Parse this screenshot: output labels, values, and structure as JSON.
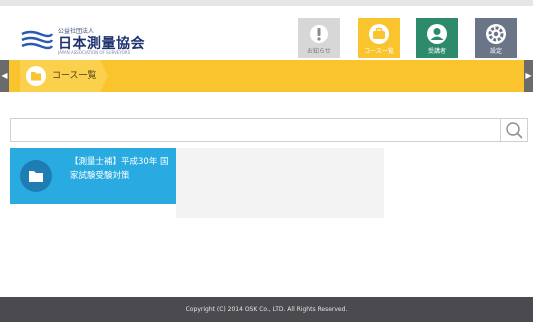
{
  "header": {
    "org_sub": "公益社団法人",
    "org_name": "日本測量協会",
    "org_en": "JAPAN ASSOCIATION OF SURVEYORS",
    "nav": [
      {
        "key": "news",
        "label": "お知らせ",
        "icon": "exclamation-icon"
      },
      {
        "key": "course",
        "label": "コース一覧",
        "icon": "briefcase-icon"
      },
      {
        "key": "learner",
        "label": "受講者",
        "icon": "user-icon"
      },
      {
        "key": "settings",
        "label": "設定",
        "icon": "gear-icon"
      }
    ]
  },
  "breadcrumb": {
    "label": "コース一覧",
    "left_arrow": "◀",
    "right_arrow": "▶"
  },
  "search": {
    "value": "",
    "placeholder": ""
  },
  "courses": [
    {
      "title": "【測量士補】平成30年 国家試験受験対策",
      "icon": "folder-icon"
    }
  ],
  "footer": {
    "copyright": "Copyright (C) 2014 OSK Co., LTD. All Rights Reserved."
  },
  "colors": {
    "accent_yellow": "#f9c42e",
    "learner_green": "#2d8a6b",
    "settings_slate": "#6a7588",
    "card_blue": "#29abe2",
    "footer_dark": "#4a4a4f"
  }
}
